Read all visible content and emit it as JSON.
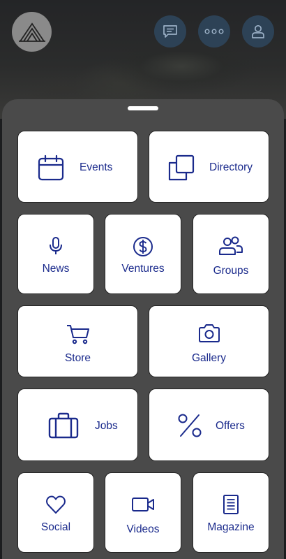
{
  "header": {
    "logo_icon": "mountain-arch-logo",
    "buttons": [
      {
        "name": "chat",
        "icon": "chat-icon"
      },
      {
        "name": "more",
        "icon": "more-horizontal-icon"
      },
      {
        "name": "profile",
        "icon": "user-icon"
      }
    ]
  },
  "colors": {
    "accent": "#1a2a8c",
    "sheet_bg": "#4a4a4a",
    "top_button_bg": "#2d4256"
  },
  "menu": {
    "events": {
      "label": "Events",
      "icon": "calendar-icon"
    },
    "directory": {
      "label": "Directory",
      "icon": "copy-icon"
    },
    "news": {
      "label": "News",
      "icon": "microphone-icon"
    },
    "ventures": {
      "label": "Ventures",
      "icon": "dollar-circle-icon"
    },
    "groups": {
      "label": "Groups",
      "icon": "users-icon"
    },
    "store": {
      "label": "Store",
      "icon": "cart-icon"
    },
    "gallery": {
      "label": "Gallery",
      "icon": "camera-icon"
    },
    "jobs": {
      "label": "Jobs",
      "icon": "briefcase-icon"
    },
    "offers": {
      "label": "Offers",
      "icon": "percent-icon"
    },
    "social": {
      "label": "Social",
      "icon": "heart-icon"
    },
    "videos": {
      "label": "Videos",
      "icon": "video-camera-icon"
    },
    "magazine": {
      "label": "Magazine",
      "icon": "document-icon"
    }
  }
}
